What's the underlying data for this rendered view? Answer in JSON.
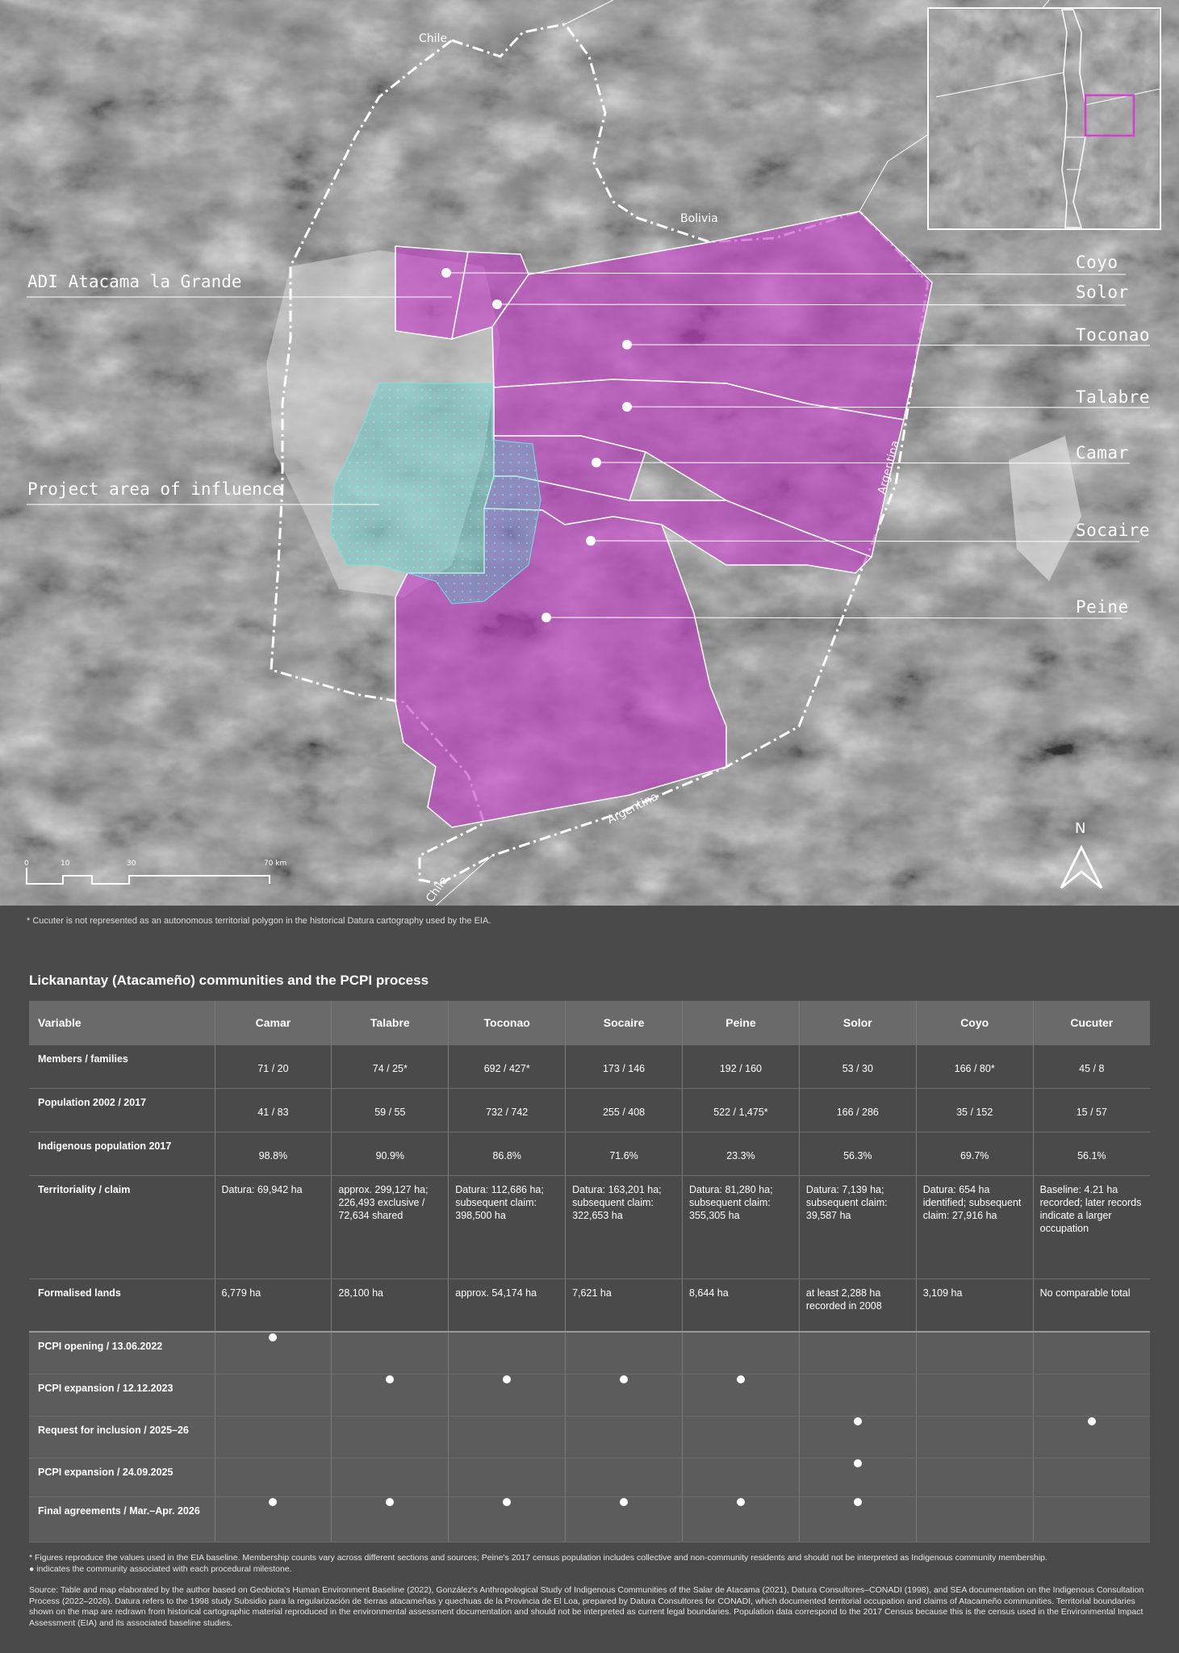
{
  "map": {
    "country_labels": [
      "Chile",
      "Bolivia",
      "Argentina",
      "Argentina",
      "Chile"
    ],
    "area_labels": {
      "adi": "ADI Atacama la Grande",
      "project": "Project area of influence"
    },
    "communities": [
      "Coyo",
      "Solor",
      "Toconao",
      "Talabre",
      "Camar",
      "Socaire",
      "Peine"
    ],
    "scale": {
      "ticks": [
        "0",
        "10",
        "30",
        "70 km"
      ]
    },
    "north": "N",
    "colors": {
      "community_fill": "#c43cc6",
      "project_fill": "#4fd0c8",
      "highlight_box": "#d43fd0"
    }
  },
  "footnote_cucuter": "* Cucuter is not represented as an autonomous territorial polygon in the historical Datura cartography used by the EIA.",
  "table": {
    "title": "Lickanantay (Atacameño) communities and the PCPI process",
    "headers": [
      "Variable",
      "Camar",
      "Talabre",
      "Toconao",
      "Socaire",
      "Peine",
      "Solor",
      "Coyo",
      "Cucuter"
    ],
    "rows": [
      {
        "label": "Members / families",
        "values": [
          "71 / 20",
          "74 / 25*",
          "692 / 427*",
          "173 / 146",
          "192 / 160",
          "53 / 30",
          "166 / 80*",
          "45 / 8"
        ]
      },
      {
        "label": "Population 2002 / 2017",
        "values": [
          "41 / 83",
          "59 / 55",
          "732 / 742",
          "255 / 408",
          "522 / 1,475*",
          "166 / 286",
          "35 / 152",
          "15 / 57"
        ]
      },
      {
        "label": "Indigenous population 2017",
        "values": [
          "98.8%",
          "90.9%",
          "86.8%",
          "71.6%",
          "23.3%",
          "56.3%",
          "69.7%",
          "56.1%"
        ]
      },
      {
        "label": "Territoriality / claim",
        "values": [
          "Datura: 69,942 ha",
          "approx. 299,127 ha; 226,493 exclusive / 72,634 shared",
          "Datura: 112,686 ha; subsequent claim: 398,500 ha",
          "Datura: 163,201 ha; subsequent claim: 322,653 ha",
          "Datura: 81,280 ha; subsequent claim: 355,305 ha",
          "Datura: 7,139 ha; subsequent claim: 39,587 ha",
          "Datura: 654 ha identified; subsequent claim: 27,916 ha",
          "Baseline: 4.21 ha recorded; later records indicate a larger occupation"
        ]
      },
      {
        "label": "Formalised lands",
        "values": [
          "6,779 ha",
          "28,100 ha",
          "approx. 54,174 ha",
          "7,621 ha",
          "8,644 ha",
          "at least 2,288 ha recorded in 2008",
          "3,109 ha",
          "No comparable total"
        ]
      }
    ],
    "pcpi_rows": [
      {
        "label": "PCPI opening / 13.06.2022",
        "marks": [
          true,
          false,
          false,
          false,
          false,
          false,
          false,
          false
        ]
      },
      {
        "label": "PCPI expansion / 12.12.2023",
        "marks": [
          false,
          true,
          true,
          true,
          true,
          false,
          false,
          false
        ]
      },
      {
        "label": "Request for inclusion / 2025–26",
        "marks": [
          false,
          false,
          false,
          false,
          false,
          true,
          false,
          true
        ]
      },
      {
        "label": "PCPI expansion / 24.09.2025",
        "marks": [
          false,
          false,
          false,
          false,
          false,
          true,
          false,
          false
        ]
      },
      {
        "label": "Final agreements / Mar.–Apr. 2026",
        "marks": [
          true,
          true,
          true,
          true,
          true,
          true,
          false,
          false
        ]
      }
    ]
  },
  "notes": {
    "figures": "* Figures reproduce the values used in the EIA baseline. Membership counts vary across different sections and sources; Peine's 2017 census population includes collective and non-community residents and should not be interpreted as Indigenous community membership.",
    "dot_legend": "● indicates the community associated with each procedural milestone.",
    "source": "Source: Table and map elaborated by the author based on Geobiota's Human Environment Baseline (2022), González's Anthropological Study of Indigenous Communities of the Salar de Atacama (2021), Datura Consultores–CONADI (1998), and SEA documentation on the Indigenous Consultation Process (2022–2026). Datura refers to the 1998 study Subsidio para la regularización de tierras atacameñas y quechuas de la Provincia de El Loa, prepared by Datura Consultores for CONADI, which documented territorial occupation and claims of Atacameño communities. Territorial boundaries shown on the map are redrawn from historical cartographic material reproduced in the environmental assessment documentation and should not be interpreted as current legal boundaries. Population data correspond to the 2017 Census because this is the census used in the Environmental Impact Assessment (EIA) and its associated baseline studies."
  }
}
